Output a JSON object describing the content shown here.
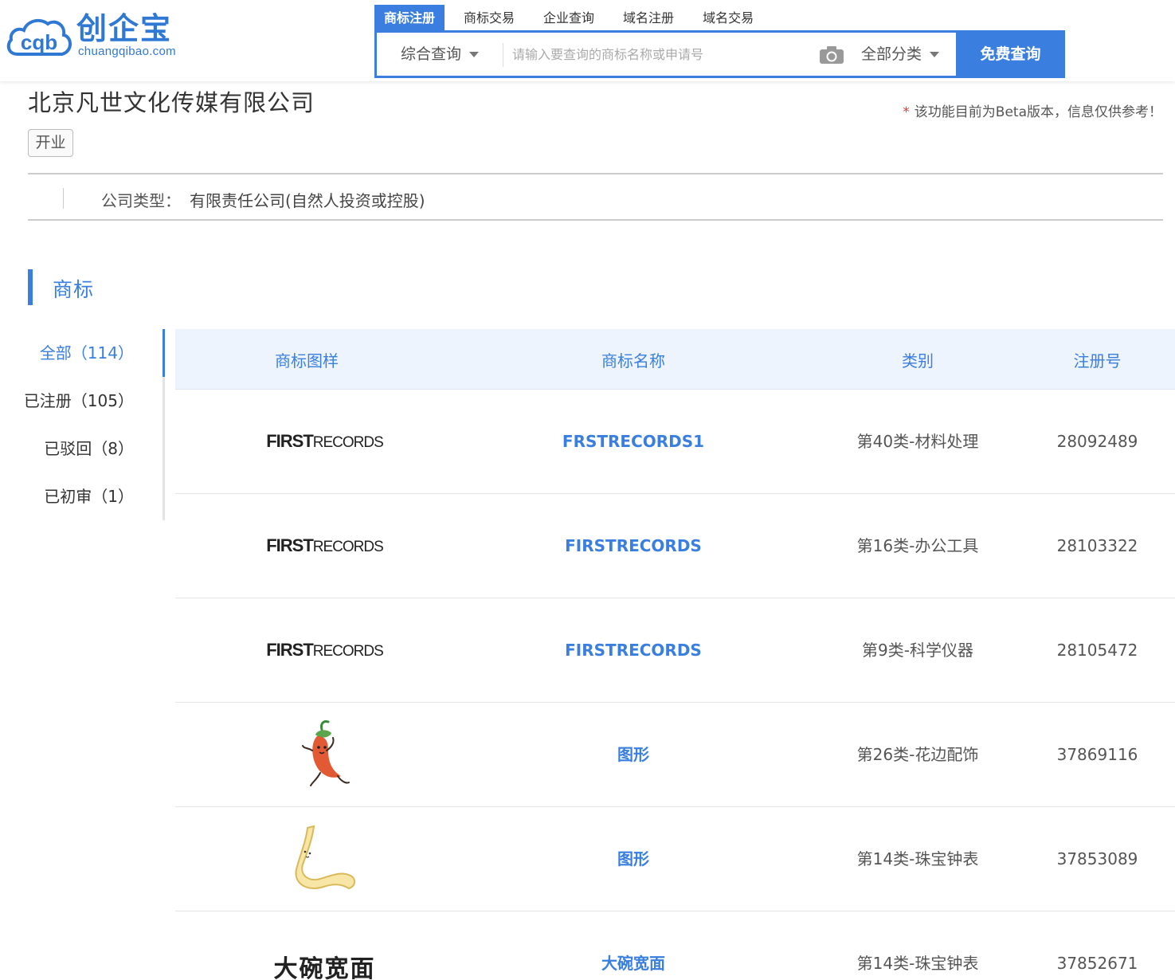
{
  "logo": {
    "short": "cqb",
    "brand": "创企宝",
    "domain": "chuangqibao.com"
  },
  "nav": {
    "tabs": [
      "商标注册",
      "商标交易",
      "企业查询",
      "域名注册",
      "域名交易"
    ],
    "active_index": 0
  },
  "search": {
    "type_label": "综合查询",
    "placeholder": "请输入要查询的商标名称或申请号",
    "category_label": "全部分类",
    "button_label": "免费查询"
  },
  "company": {
    "name": "北京凡世文化传媒有限公司",
    "status": "开业",
    "beta_star": "*",
    "beta_note": "该功能目前为Beta版本，信息仅供参考！",
    "type_label": "公司类型：",
    "type_value": "有限责任公司(自然人投资或控股)"
  },
  "section": {
    "title": "商标"
  },
  "filters": [
    {
      "label": "全部（114）",
      "active": true
    },
    {
      "label": "已注册（105）",
      "active": false
    },
    {
      "label": "已驳回（8）",
      "active": false
    },
    {
      "label": "已初审（1）",
      "active": false
    }
  ],
  "table": {
    "headers": [
      "商标图样",
      "商标名称",
      "类别",
      "注册号"
    ],
    "rows": [
      {
        "logo_type": "firstrecords",
        "logo_text_bold": "FIRST",
        "logo_text_thin": "RECORDS",
        "name": "FRSTRECORDS1",
        "class": "第40类-材料处理",
        "reg_no": "28092489"
      },
      {
        "logo_type": "firstrecords",
        "logo_text_bold": "FIRST",
        "logo_text_thin": "RECORDS",
        "name": "FIRSTRECORDS",
        "class": "第16类-办公工具",
        "reg_no": "28103322"
      },
      {
        "logo_type": "firstrecords",
        "logo_text_bold": "FIRST",
        "logo_text_thin": "RECORDS",
        "name": "FIRSTRECORDS",
        "class": "第9类-科学仪器",
        "reg_no": "28105472"
      },
      {
        "logo_type": "pepper-icon",
        "name": "图形",
        "class": "第26类-花边配饰",
        "reg_no": "37869116"
      },
      {
        "logo_type": "noodle-icon",
        "name": "图形",
        "class": "第14类-珠宝钟表",
        "reg_no": "37853089"
      },
      {
        "logo_type": "text",
        "logo_text": "大碗宽面",
        "name": "大碗宽面",
        "class": "第14类-珠宝钟表",
        "reg_no": "37852671"
      }
    ]
  },
  "colors": {
    "accent": "#3a7fe0",
    "header_bg": "#eef4fd",
    "warning_star": "#e53935"
  }
}
